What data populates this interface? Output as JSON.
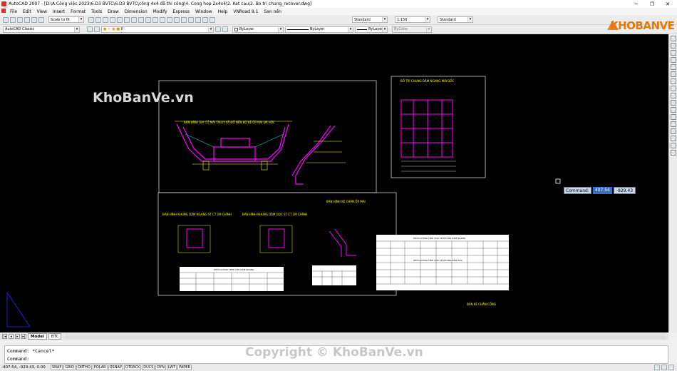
{
  "window": {
    "title": "AutoCAD 2007 - [D:\\A.Công việc 2023\\6.D3 BVTC\\6.D3 BVTC\\cống 4x4 đã thi công\\4. Cong hop 2x4x4\\2. Ket cau\\2. Bo tri chung_recover.dwg]",
    "minimize": "─",
    "restore": "❐",
    "close": "✕"
  },
  "menu": [
    "File",
    "Edit",
    "View",
    "Insert",
    "Format",
    "Tools",
    "Draw",
    "Dimension",
    "Modify",
    "Express",
    "Window",
    "Help",
    "VNRoad 9.1",
    "San nền"
  ],
  "toolbars": {
    "scale_combo": "Scale to fit",
    "text_style": "Standard",
    "dim_scale": "1:150",
    "dim_style": "Standard",
    "workspace": "AutoCAD Classic",
    "layer_value": "0",
    "color": "ByLayer",
    "linetype": "ByLayer",
    "lineweight": "ByLayer",
    "plotstyle": "ByColor"
  },
  "dynamic_input": {
    "label": "Command:",
    "x": "407.54",
    "y": "-929.43"
  },
  "tabs": {
    "model": "Model",
    "layout": "BTC"
  },
  "command_lines": [
    "Command: *Cancel*",
    "Command:"
  ],
  "status": {
    "coords": "-407.54, -929.43, 0.00",
    "buttons": [
      "SNAP",
      "GRID",
      "ORTHO",
      "POLAR",
      "OSNAP",
      "OTRACK",
      "DUCS",
      "DYN",
      "LWT",
      "PAPER"
    ]
  },
  "watermarks": {
    "canvas_text": "KhoBanVe.vn",
    "logo_text": "KHOBANVE",
    "copyright": "Copyright © KhoBanVe.vn"
  },
  "drawing": {
    "sheet1_title": "BẢN HÌNH GIA CỐ MÁI TALUY VÀ ĐỔ NỀN BỘ KÊ ỐP MÁI ĐÁ HỘC",
    "sheet2_title": "BỐ TRÍ CHUNG DẦM NGANG MÁI DỐC",
    "sheet3_title_a": "BẢN HÌNH KHUNG DẦM NGANG ST CT 2M CHÍNH",
    "sheet3_title_b": "BẢN HÌNH KHUNG DẦM DỌC ST CT 2M CHÍNH",
    "sheet3_title_c": "BẢN HÌNH KÈ CHÂN ỐP MÁI",
    "table_title_1": "KHỐI LƯỢNG THÉP CHO DẦM NGANG",
    "table_title_2": "KHỐI LƯỢNG TÍNH CHO 1M KHUNG DẦM NGANG",
    "table_title_3": "KHỐI LƯỢNG TÍNH CHO 1M KHUNG DẦM DỌC",
    "note_bottom": "BẢN KÈ CHÂN CỐNG"
  }
}
